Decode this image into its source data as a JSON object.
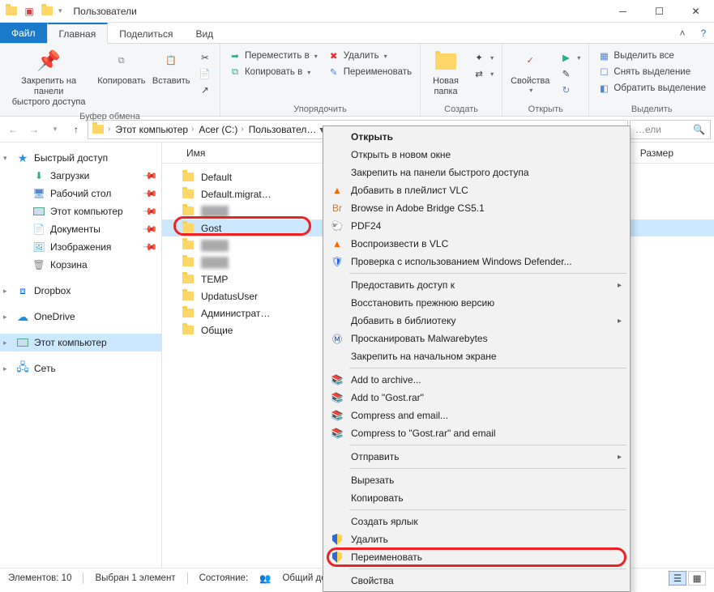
{
  "window": {
    "title": "Пользователи"
  },
  "tabs": {
    "file": "Файл",
    "home": "Главная",
    "share": "Поделиться",
    "view": "Вид"
  },
  "ribbon": {
    "clipboard": {
      "label": "Буфер обмена",
      "pin": "Закрепить на панели\nбыстрого доступа",
      "copy": "Копировать",
      "paste": "Вставить"
    },
    "organize": {
      "label": "Упорядочить",
      "move": "Переместить в",
      "copyTo": "Копировать в",
      "delete": "Удалить",
      "rename": "Переименовать"
    },
    "create": {
      "label": "Создать",
      "newFolder": "Новая\nпапка"
    },
    "open": {
      "label": "Открыть",
      "properties": "Свойства"
    },
    "select": {
      "label": "Выделить",
      "all": "Выделить все",
      "none": "Снять выделение",
      "invert": "Обратить выделение"
    }
  },
  "breadcrumb": [
    "Этот компьютер",
    "Acer (C:)",
    "Пользовател…"
  ],
  "search": {
    "placeholder": "…ели"
  },
  "columns": {
    "name": "Имя",
    "size": "Размер"
  },
  "nav": {
    "quick": "Быстрый доступ",
    "downloads": "Загрузки",
    "desktop": "Рабочий стол",
    "thispc": "Этот компьютер",
    "documents": "Документы",
    "pictures": "Изображения",
    "recycle": "Корзина",
    "dropbox": "Dropbox",
    "onedrive": "OneDrive",
    "thispc2": "Этот компьютер",
    "network": "Сеть"
  },
  "files": [
    "Default",
    "Default.migrat…",
    "",
    "Gost",
    "",
    "",
    "TEMP",
    "UpdatusUser",
    "Администрат…",
    "Общие"
  ],
  "ctx": {
    "open": "Открыть",
    "openNew": "Открыть в новом окне",
    "pinQuick": "Закрепить на панели быстрого доступа",
    "vlcAdd": "Добавить в плейлист VLC",
    "bridge": "Browse in Adobe Bridge CS5.1",
    "pdf24": "PDF24",
    "vlcPlay": "Воспроизвести в VLC",
    "defender": "Проверка с использованием Windows Defender...",
    "share": "Предоставить доступ к",
    "restore": "Восстановить прежнюю версию",
    "library": "Добавить в библиотеку",
    "malware": "Просканировать Malwarebytes",
    "pinStart": "Закрепить на начальном экране",
    "rarAdd": "Add to archive...",
    "rarGost": "Add to \"Gost.rar\"",
    "rarMail": "Compress and email...",
    "rarGostMail": "Compress to \"Gost.rar\" and email",
    "send": "Отправить",
    "cut": "Вырезать",
    "copy": "Копировать",
    "shortcut": "Создать ярлык",
    "delete": "Удалить",
    "rename": "Переименовать",
    "props": "Свойства"
  },
  "status": {
    "elements": "Элементов: 10",
    "selected": "Выбран 1 элемент",
    "state": "Состояние:",
    "shared": "Общий досту…"
  }
}
